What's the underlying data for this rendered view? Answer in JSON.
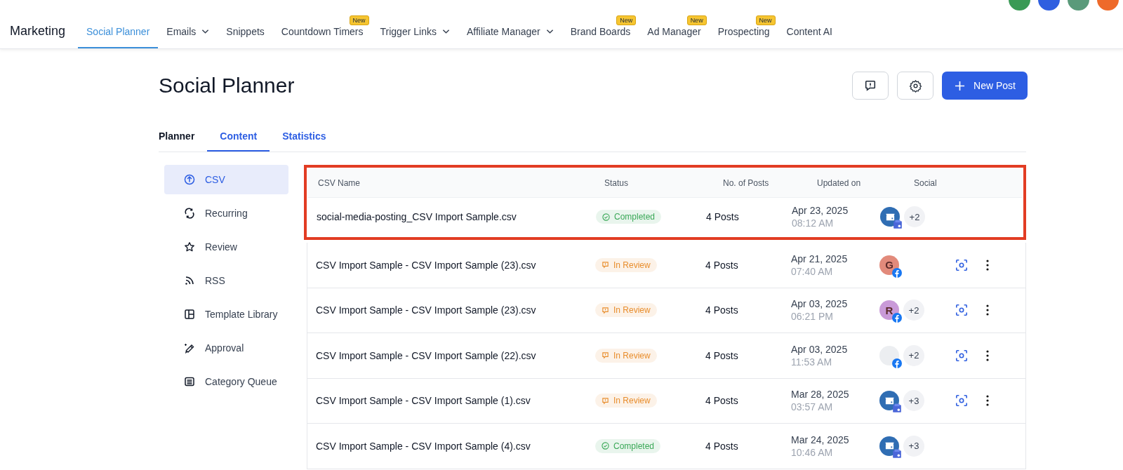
{
  "app_title": "Marketing",
  "nav": [
    {
      "label": "Social Planner",
      "selected": true,
      "dropdown": false
    },
    {
      "label": "Emails",
      "selected": false,
      "dropdown": true
    },
    {
      "label": "Snippets",
      "selected": false,
      "dropdown": false
    },
    {
      "label": "Countdown Timers",
      "selected": false,
      "dropdown": false,
      "badge": "New"
    },
    {
      "label": "Trigger Links",
      "selected": false,
      "dropdown": true
    },
    {
      "label": "Affiliate Manager",
      "selected": false,
      "dropdown": true
    },
    {
      "label": "Brand Boards",
      "selected": false,
      "dropdown": false,
      "badge": "New"
    },
    {
      "label": "Ad Manager",
      "selected": false,
      "dropdown": false,
      "badge": "New"
    },
    {
      "label": "Prospecting",
      "selected": false,
      "dropdown": false,
      "badge": "New"
    },
    {
      "label": "Content AI",
      "selected": false,
      "dropdown": false
    }
  ],
  "page_title": "Social Planner",
  "new_post_button": "New Post",
  "tabs": [
    {
      "label": "Planner",
      "selected": false
    },
    {
      "label": "Content",
      "selected": true
    },
    {
      "label": "Statistics",
      "selected": false
    }
  ],
  "sidebar": [
    {
      "label": "CSV",
      "selected": true
    },
    {
      "label": "Recurring",
      "selected": false
    },
    {
      "label": "Review",
      "selected": false
    },
    {
      "label": "RSS",
      "selected": false
    },
    {
      "label": "Template Library",
      "selected": false
    },
    {
      "label": "Approval",
      "selected": false
    },
    {
      "label": "Category Queue",
      "selected": false
    }
  ],
  "table": {
    "columns": [
      "CSV Name",
      "Status",
      "No. of Posts",
      "Updated on",
      "Social"
    ],
    "rows": [
      {
        "name": "social-media-posting_CSV Import Sample.csv",
        "status": {
          "label": "Completed",
          "kind": "done",
          "color": "#3aa857"
        },
        "posts": "4 Posts",
        "date": "Apr 23, 2025",
        "time": "08:12 AM",
        "avatar": {
          "kind": "store",
          "color": "#2f6db3"
        },
        "extra": "+2",
        "actions": false,
        "highlighted": true
      },
      {
        "name": "CSV Import Sample - CSV Import Sample (23).csv",
        "status": {
          "label": "In Review",
          "kind": "review",
          "color": "#e88d2c"
        },
        "posts": "4 Posts",
        "date": "Apr 21, 2025",
        "time": "07:40 AM",
        "avatar": {
          "kind": "letter",
          "letter": "G",
          "color": "#e28a7b"
        },
        "actions": true,
        "highlighted": false
      },
      {
        "name": "CSV Import Sample - CSV Import Sample (23).csv",
        "status": {
          "label": "In Review",
          "kind": "review",
          "color": "#e88d2c"
        },
        "posts": "4 Posts",
        "date": "Apr 03, 2025",
        "time": "06:21 PM",
        "avatar": {
          "kind": "letter",
          "letter": "R",
          "color": "#c99ad8"
        },
        "extra": "+2",
        "actions": true,
        "highlighted": false
      },
      {
        "name": "CSV Import Sample - CSV Import Sample (22).csv",
        "status": {
          "label": "In Review",
          "kind": "review",
          "color": "#e88d2c"
        },
        "posts": "4 Posts",
        "date": "Apr 03, 2025",
        "time": "11:53 AM",
        "avatar": {
          "kind": "image"
        },
        "extra": "+2",
        "actions": true,
        "highlighted": false
      },
      {
        "name": "CSV Import Sample - CSV Import Sample (1).csv",
        "status": {
          "label": "In Review",
          "kind": "review",
          "color": "#e88d2c"
        },
        "posts": "4 Posts",
        "date": "Mar 28, 2025",
        "time": "03:57 AM",
        "avatar": {
          "kind": "store",
          "color": "#2f6db3"
        },
        "extra": "+3",
        "actions": true,
        "highlighted": false
      },
      {
        "name": "CSV Import Sample - CSV Import Sample (4).csv",
        "status": {
          "label": "Completed",
          "kind": "done",
          "color": "#3aa857"
        },
        "posts": "4 Posts",
        "date": "Mar 24, 2025",
        "time": "10:46 AM",
        "avatar": {
          "kind": "store",
          "color": "#2f6db3"
        },
        "extra": "+3",
        "actions": false,
        "highlighted": false
      }
    ]
  }
}
